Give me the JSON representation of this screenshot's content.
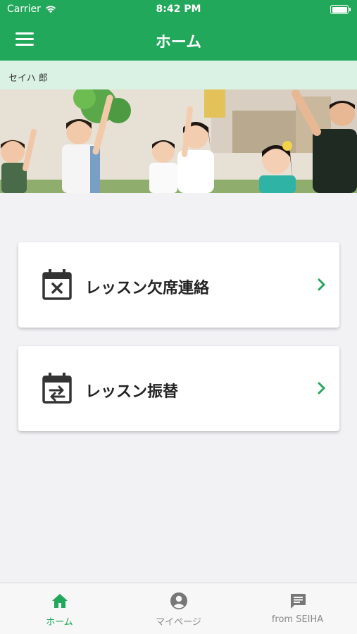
{
  "status_bar": {
    "carrier": "Carrier",
    "time": "8:42 PM"
  },
  "header": {
    "title": "ホーム",
    "menu_icon": "hamburger-menu-icon"
  },
  "user": {
    "name": "セイハ 郎"
  },
  "hero": {
    "image": "children-raising-hands-photo"
  },
  "menu_cards": [
    {
      "label": "レッスン欠席連絡",
      "icon": "calendar-x-icon"
    },
    {
      "label": "レッスン振替",
      "icon": "calendar-swap-icon"
    }
  ],
  "tabs": [
    {
      "label": "ホーム",
      "icon": "home-icon",
      "active": true
    },
    {
      "label": "マイページ",
      "icon": "account-circle-icon",
      "active": false
    },
    {
      "label": "from SEIHA",
      "icon": "message-icon",
      "active": false
    }
  ],
  "colors": {
    "brand_green": "#21a85a",
    "strip_green": "#d9f2e3",
    "background": "#f2f2f5",
    "inactive_tab": "#8a8a8a"
  }
}
